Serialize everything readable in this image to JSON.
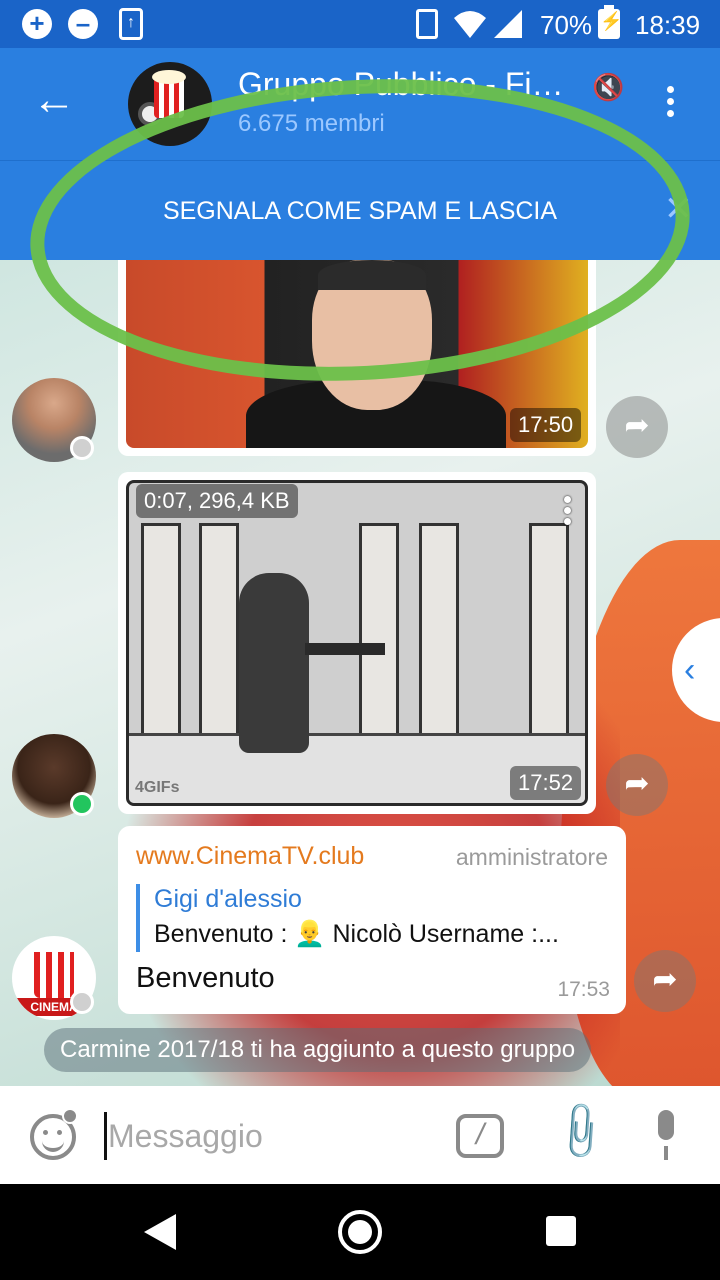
{
  "status_bar": {
    "battery_percent": "70%",
    "time": "18:39",
    "left_icons": [
      "chat-plus-icon",
      "minus-circle-icon",
      "upload-icon"
    ],
    "right_icons": [
      "phone-icon",
      "wifi-icon",
      "signal-icon",
      "battery-charging-icon"
    ]
  },
  "header": {
    "title": "Gruppo Pubblico - Fi…",
    "subtitle": "6.675 membri",
    "back_icon": "←",
    "muted_icon": "🔇"
  },
  "spam_banner": {
    "label": "SEGNALA COME SPAM E LASCIA",
    "close_icon": "✕"
  },
  "messages": [
    {
      "type": "photo",
      "time": "17:50"
    },
    {
      "type": "video",
      "meta": "0:07, 296,4 KB",
      "time": "17:52",
      "watermark": "4GIFs"
    },
    {
      "type": "text",
      "sender": "www.CinemaTV.club",
      "role": "amministratore",
      "reply_name": "Gigi d'alessio",
      "reply_text": "Benvenuto : 👱‍♂️ Nicolò  Username :...",
      "body": "Benvenuto",
      "time": "17:53"
    }
  ],
  "avatar_label": "CINEMA",
  "service_message": "Carmine 2017/18 ti ha aggiunto a questo gruppo",
  "composer": {
    "placeholder": "Messaggio",
    "command_icon": "/",
    "attach_icon": "📎"
  },
  "forward_icon": "➦",
  "side_tab_icon": "‹",
  "colors": {
    "status_bar": "#1a64c8",
    "app_bar": "#2a7fe0",
    "annotation_circle": "#6cc04a",
    "online_dot": "#22c55e",
    "sender_name": "#e47a1e",
    "reply_accent": "#3d8ee6"
  }
}
